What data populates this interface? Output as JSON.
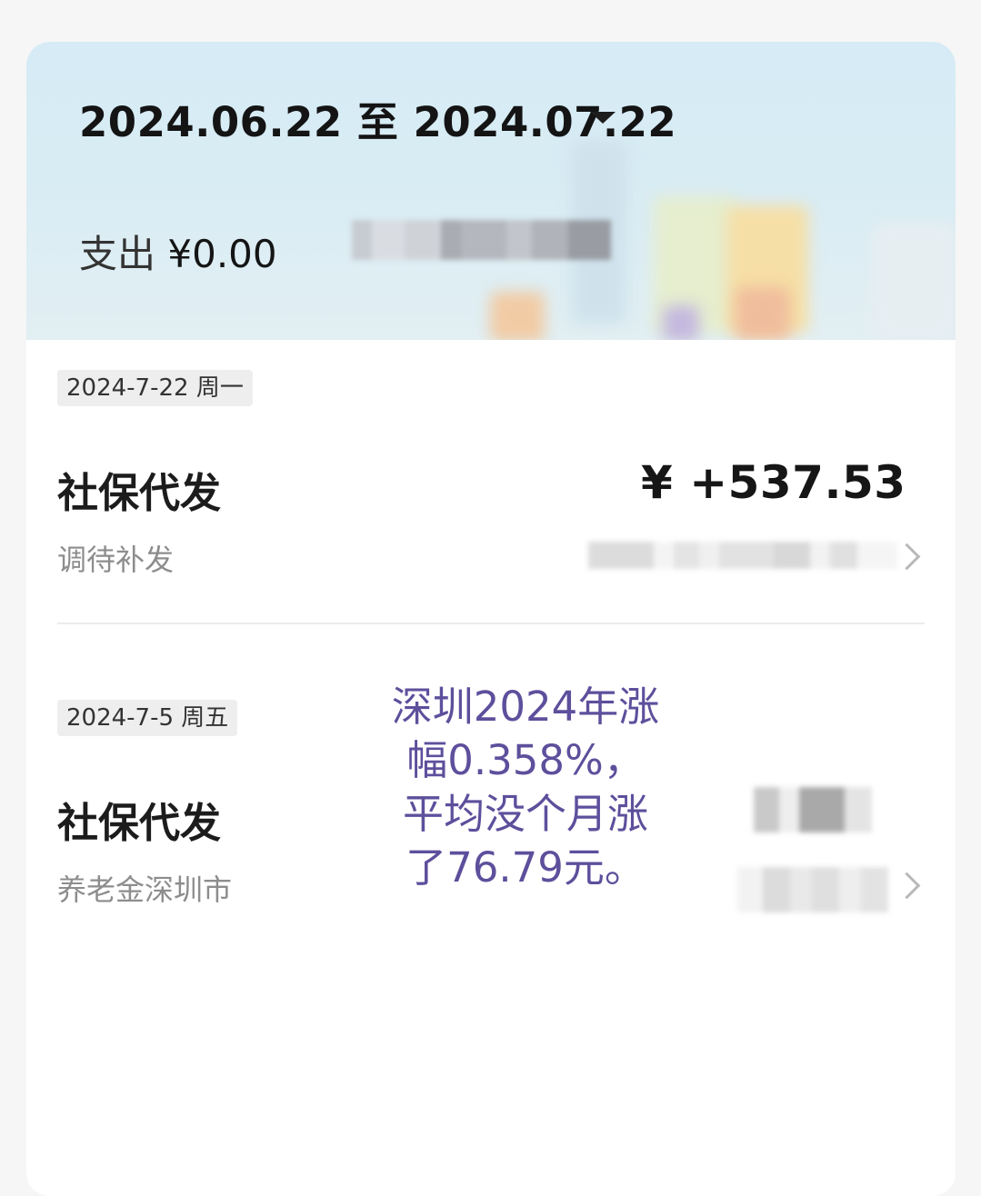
{
  "header": {
    "date_range": "2024.06.22 至 2024.07.22",
    "expense_label": "支出",
    "expense_amount": "¥0.00"
  },
  "transactions": [
    {
      "date": "2024-7-22 周一",
      "title": "社保代发",
      "subtitle": "调待补发",
      "amount": "¥ +537.53"
    },
    {
      "date": "2024-7-5 周五",
      "title": "社保代发",
      "subtitle": "养老金深圳市"
    }
  ],
  "annotation": {
    "lines": [
      "深圳2024年涨",
      "幅0.358%，",
      "平均没个月涨",
      "了76.79元。"
    ]
  },
  "colors": {
    "header_bg": "#d6ebf5",
    "annotation_text": "#5e4f9c",
    "date_badge_bg": "#eeeeee"
  }
}
